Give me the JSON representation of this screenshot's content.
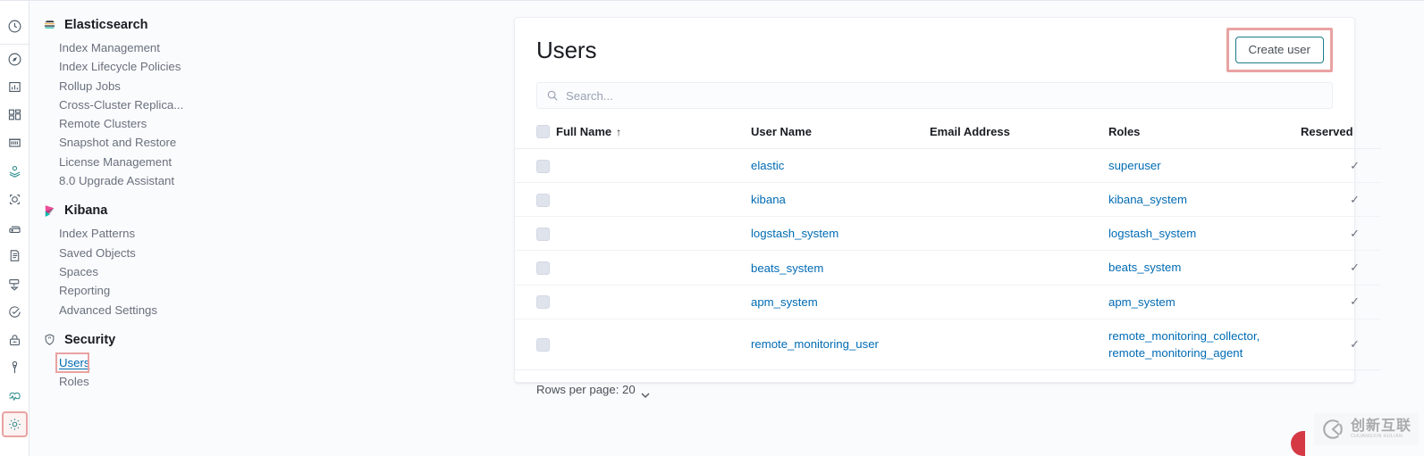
{
  "rail": {
    "items": [
      {
        "name": "recently-viewed-icon",
        "title": "Recently viewed"
      },
      {
        "name": "discover-icon",
        "title": "Discover"
      },
      {
        "name": "visualize-icon",
        "title": "Visualize"
      },
      {
        "name": "dashboard-icon",
        "title": "Dashboard"
      },
      {
        "name": "canvas-icon",
        "title": "Canvas"
      },
      {
        "name": "maps-icon",
        "title": "Maps"
      },
      {
        "name": "machine-learning-icon",
        "title": "Machine Learning"
      },
      {
        "name": "infrastructure-icon",
        "title": "Infrastructure"
      },
      {
        "name": "logs-icon",
        "title": "Logs"
      },
      {
        "name": "apm-icon",
        "title": "APM"
      },
      {
        "name": "uptime-icon",
        "title": "Uptime"
      },
      {
        "name": "siem-icon",
        "title": "SIEM"
      },
      {
        "name": "dev-tools-icon",
        "title": "Dev Tools"
      },
      {
        "name": "monitoring-icon",
        "title": "Monitoring"
      },
      {
        "name": "management-icon",
        "title": "Management"
      }
    ]
  },
  "nav": {
    "groups": [
      {
        "title": "Elasticsearch",
        "icon": "elasticsearch-logo",
        "items": [
          {
            "label": "Index Management",
            "active": false
          },
          {
            "label": "Index Lifecycle Policies",
            "active": false
          },
          {
            "label": "Rollup Jobs",
            "active": false
          },
          {
            "label": "Cross-Cluster Replica...",
            "active": false
          },
          {
            "label": "Remote Clusters",
            "active": false
          },
          {
            "label": "Snapshot and Restore",
            "active": false
          },
          {
            "label": "License Management",
            "active": false
          },
          {
            "label": "8.0 Upgrade Assistant",
            "active": false
          }
        ]
      },
      {
        "title": "Kibana",
        "icon": "kibana-logo",
        "items": [
          {
            "label": "Index Patterns",
            "active": false
          },
          {
            "label": "Saved Objects",
            "active": false
          },
          {
            "label": "Spaces",
            "active": false
          },
          {
            "label": "Reporting",
            "active": false
          },
          {
            "label": "Advanced Settings",
            "active": false
          }
        ]
      },
      {
        "title": "Security",
        "icon": "shield-icon",
        "items": [
          {
            "label": "Users",
            "active": true,
            "highlighted": true
          },
          {
            "label": "Roles",
            "active": false
          }
        ]
      }
    ]
  },
  "main": {
    "title": "Users",
    "create_button_label": "Create user",
    "search": {
      "placeholder": "Search...",
      "value": ""
    },
    "table": {
      "columns": [
        {
          "label": "",
          "key": "checkbox"
        },
        {
          "label": "Full Name",
          "key": "full_name",
          "sorted": "asc",
          "sort_glyph": "↑"
        },
        {
          "label": "User Name",
          "key": "user_name"
        },
        {
          "label": "Email Address",
          "key": "email"
        },
        {
          "label": "Roles",
          "key": "roles"
        },
        {
          "label": "Reserved",
          "key": "reserved"
        }
      ],
      "rows": [
        {
          "full_name": "",
          "user_name": "elastic",
          "email": "",
          "roles": "superuser",
          "reserved": "✓"
        },
        {
          "full_name": "",
          "user_name": "kibana",
          "email": "",
          "roles": "kibana_system",
          "reserved": "✓"
        },
        {
          "full_name": "",
          "user_name": "logstash_system",
          "email": "",
          "roles": "logstash_system",
          "reserved": "✓"
        },
        {
          "full_name": "",
          "user_name": "beats_system",
          "email": "",
          "roles": "beats_system",
          "reserved": "✓"
        },
        {
          "full_name": "",
          "user_name": "apm_system",
          "email": "",
          "roles": "apm_system",
          "reserved": "✓"
        },
        {
          "full_name": "",
          "user_name": "remote_monitoring_user",
          "email": "",
          "roles": "remote_monitoring_collector,\nremote_monitoring_agent",
          "reserved": "✓"
        }
      ]
    },
    "footer": {
      "rows_per_page_label": "Rows per page: 20"
    }
  },
  "watermark": {
    "cn": "创新互联",
    "pinyin": "CHUANGXIN HULIAN"
  },
  "colors": {
    "link": "#006bb4",
    "highlight_border": "#e9a2a2",
    "button_border": "#1b7b8a",
    "text_primary": "#1a1c21",
    "text_muted": "#69707d",
    "panel_bg": "#ffffff",
    "page_bg": "#fafbfd"
  }
}
